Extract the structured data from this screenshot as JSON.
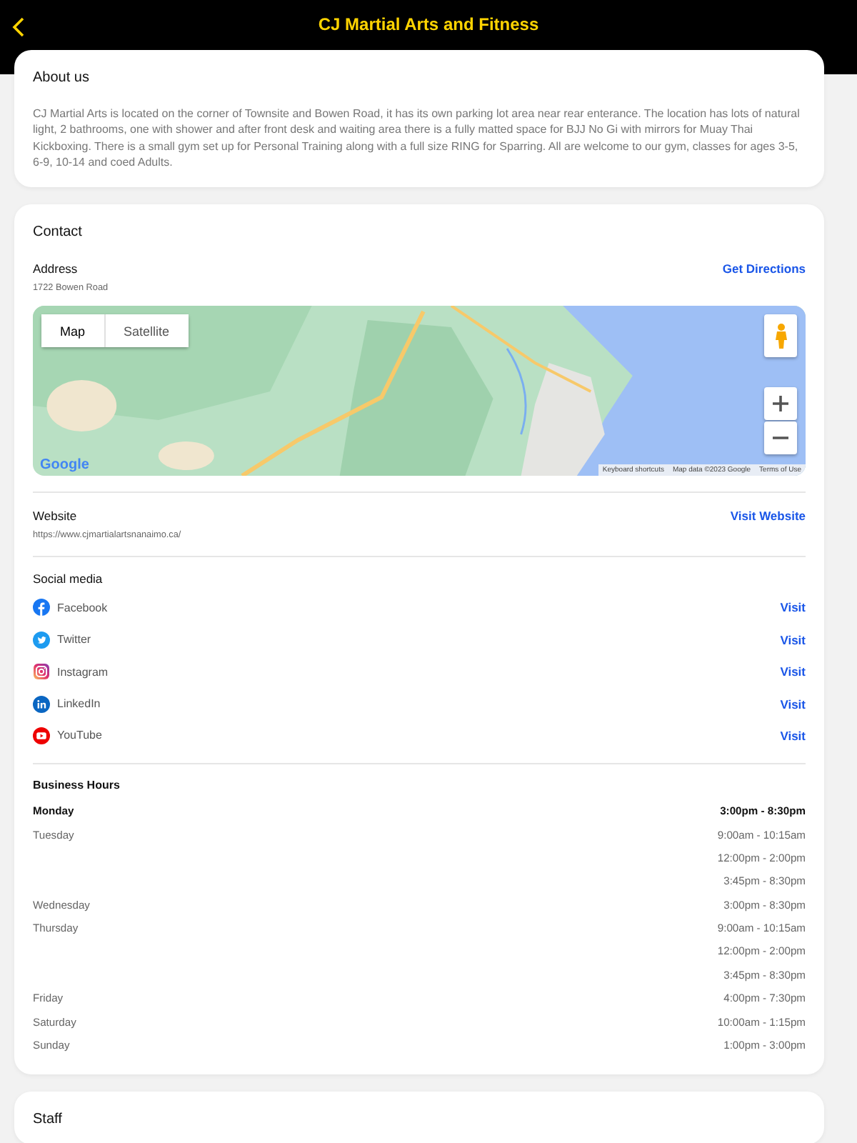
{
  "header": {
    "title": "CJ Martial Arts and Fitness"
  },
  "about": {
    "title": "About us",
    "text": "CJ Martial Arts is located on the corner of Townsite and Bowen Road, it has its own parking lot area near rear enterance. The location has lots of natural light, 2 bathrooms, one with shower and after front desk and waiting area there is a fully matted space for BJJ  No Gi with mirrors for Muay Thai Kickboxing. There is  a small gym set up for Personal Training along with a full size RING for Sparring. All are welcome to our gym, classes for ages 3-5, 6-9, 10-14 and coed Adults."
  },
  "contact": {
    "title": "Contact",
    "address": {
      "label": "Address",
      "value": "1722 Bowen Road",
      "action": "Get Directions"
    },
    "map": {
      "map_types": [
        {
          "label": "Map",
          "selected": true
        },
        {
          "label": "Satellite",
          "selected": false
        }
      ],
      "logo": "Google",
      "attribution": [
        "Keyboard shortcuts",
        "Map data ©2023 Google",
        "Terms of Use"
      ]
    },
    "website": {
      "label": "Website",
      "value": "https://www.cjmartialartsnanaimo.ca/",
      "action": "Visit Website"
    },
    "social": {
      "title": "Social media",
      "items": [
        {
          "kind": "facebook",
          "label": "Facebook",
          "action": "Visit"
        },
        {
          "kind": "twitter",
          "label": "Twitter",
          "action": "Visit"
        },
        {
          "kind": "instagram",
          "label": "Instagram",
          "action": "Visit"
        },
        {
          "kind": "linkedin",
          "label": "LinkedIn",
          "action": "Visit"
        },
        {
          "kind": "youtube",
          "label": "YouTube",
          "action": "Visit"
        }
      ]
    },
    "hours": {
      "title": "Business Hours",
      "days": [
        {
          "day": "Monday",
          "today": true,
          "slots": [
            "3:00pm - 8:30pm"
          ]
        },
        {
          "day": "Tuesday",
          "today": false,
          "slots": [
            "9:00am - 10:15am",
            "12:00pm - 2:00pm",
            "3:45pm - 8:30pm"
          ]
        },
        {
          "day": "Wednesday",
          "today": false,
          "slots": [
            "3:00pm - 8:30pm"
          ]
        },
        {
          "day": "Thursday",
          "today": false,
          "slots": [
            "9:00am - 10:15am",
            "12:00pm - 2:00pm",
            "3:45pm - 8:30pm"
          ]
        },
        {
          "day": "Friday",
          "today": false,
          "slots": [
            "4:00pm - 7:30pm"
          ]
        },
        {
          "day": "Saturday",
          "today": false,
          "slots": [
            "10:00am - 1:15pm"
          ]
        },
        {
          "day": "Sunday",
          "today": false,
          "slots": [
            "1:00pm - 3:00pm"
          ]
        }
      ]
    }
  },
  "staff": {
    "title": "Staff"
  }
}
